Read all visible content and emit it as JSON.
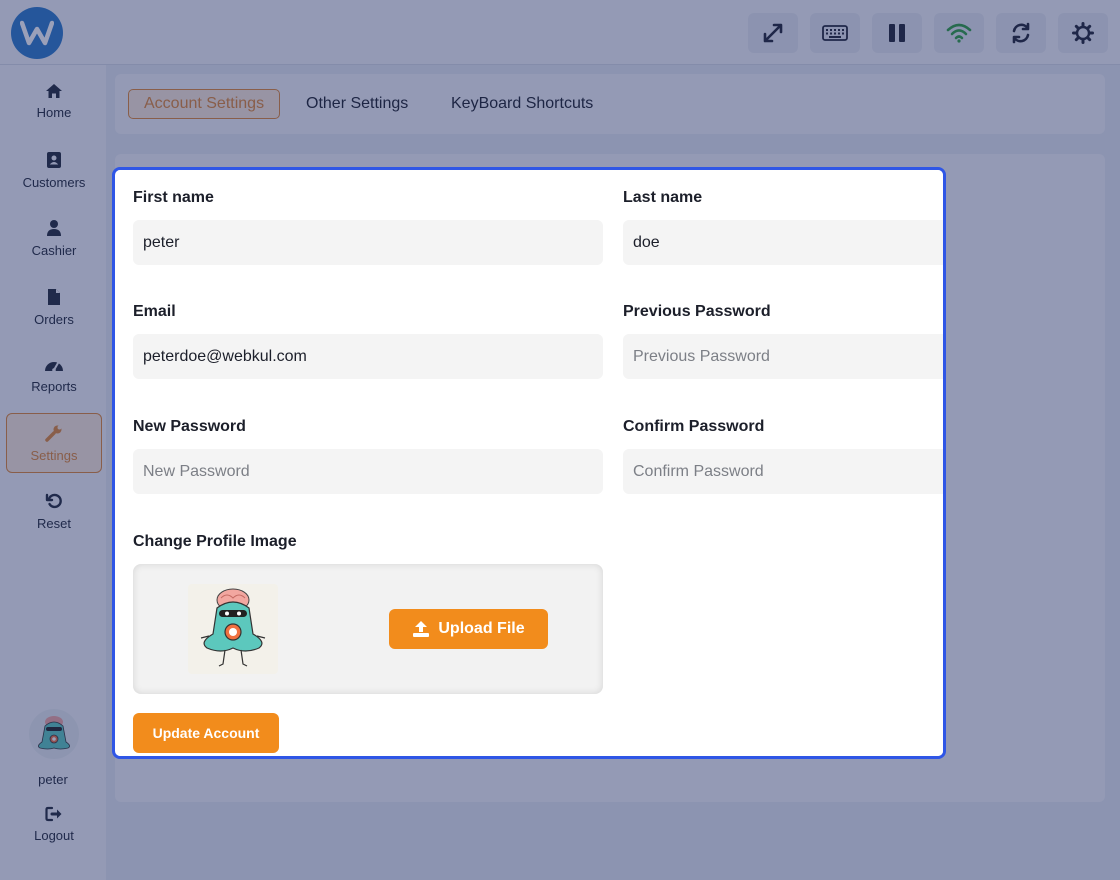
{
  "header": {
    "logo_icon": "webkul-logo",
    "toolbar": [
      {
        "icon": "fullscreen-icon"
      },
      {
        "icon": "keyboard-icon"
      },
      {
        "icon": "pause-icon"
      },
      {
        "icon": "wifi-icon"
      },
      {
        "icon": "sync-icon"
      },
      {
        "icon": "gear-icon"
      }
    ]
  },
  "sidebar": {
    "items": [
      {
        "label": "Home",
        "icon": "home-icon"
      },
      {
        "label": "Customers",
        "icon": "address-book-icon"
      },
      {
        "label": "Cashier",
        "icon": "user-icon"
      },
      {
        "label": "Orders",
        "icon": "file-icon"
      },
      {
        "label": "Reports",
        "icon": "gauge-icon"
      },
      {
        "label": "Settings",
        "icon": "wrench-icon",
        "active": true
      },
      {
        "label": "Reset",
        "icon": "reset-icon"
      }
    ],
    "user": {
      "name": "peter"
    },
    "logout_label": "Logout"
  },
  "tabs": [
    {
      "label": "Account Settings",
      "active": true
    },
    {
      "label": "Other Settings"
    },
    {
      "label": "KeyBoard Shortcuts"
    }
  ],
  "form": {
    "first_name": {
      "label": "First name",
      "value": "peter"
    },
    "last_name": {
      "label": "Last name",
      "value": "doe"
    },
    "email": {
      "label": "Email",
      "value": "peterdoe@webkul.com"
    },
    "previous_password": {
      "label": "Previous Password",
      "placeholder": "Previous Password"
    },
    "new_password": {
      "label": "New Password",
      "placeholder": "New Password"
    },
    "confirm_password": {
      "label": "Confirm Password",
      "placeholder": "Confirm Password"
    },
    "profile_image": {
      "label": "Change Profile Image",
      "upload_label": "Upload File"
    },
    "submit_label": "Update Account"
  },
  "colors": {
    "accent": "#f28c1c",
    "active_tab_border": "#e08836",
    "highlight_border": "#2f56e6",
    "wifi": "#2e9e3f"
  }
}
